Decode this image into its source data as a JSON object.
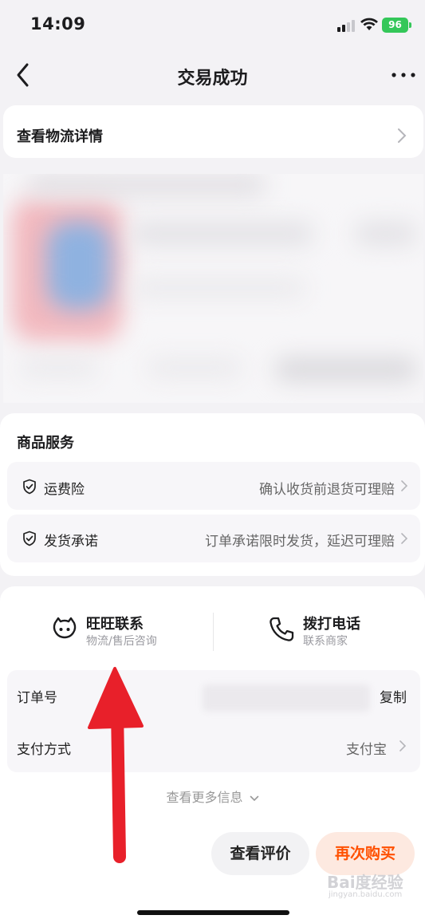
{
  "status_bar": {
    "time": "14:09",
    "battery": "96"
  },
  "nav": {
    "title": "交易成功"
  },
  "logistics": {
    "label": "查看物流详情"
  },
  "services": {
    "title": "商品服务",
    "items": [
      {
        "label": "运费险",
        "value": "确认收货前退货可理赔"
      },
      {
        "label": "发货承诺",
        "value": "订单承诺限时发货，延迟可理赔"
      }
    ]
  },
  "contact": {
    "wangwang": {
      "main": "旺旺联系",
      "sub": "物流/售后咨询"
    },
    "phone": {
      "main": "拨打电话",
      "sub": "联系商家"
    }
  },
  "order_info": {
    "order_no_label": "订单号",
    "copy_label": "复制",
    "payment_label": "支付方式",
    "payment_value": "支付宝",
    "more_label": "查看更多信息"
  },
  "actions": {
    "review_label": "查看评价",
    "rebuy_label": "再次购买"
  },
  "watermark": {
    "main": "Bai度经验",
    "sub": "jingyan.baidu.com"
  },
  "colors": {
    "accent": "#ff5000",
    "annotation_arrow": "#e8202a",
    "battery": "#34c759"
  },
  "icons": [
    "back-icon",
    "more-icon",
    "chevron-right-icon",
    "shield-check-icon",
    "wangwang-icon",
    "phone-icon",
    "chevron-down-icon"
  ]
}
